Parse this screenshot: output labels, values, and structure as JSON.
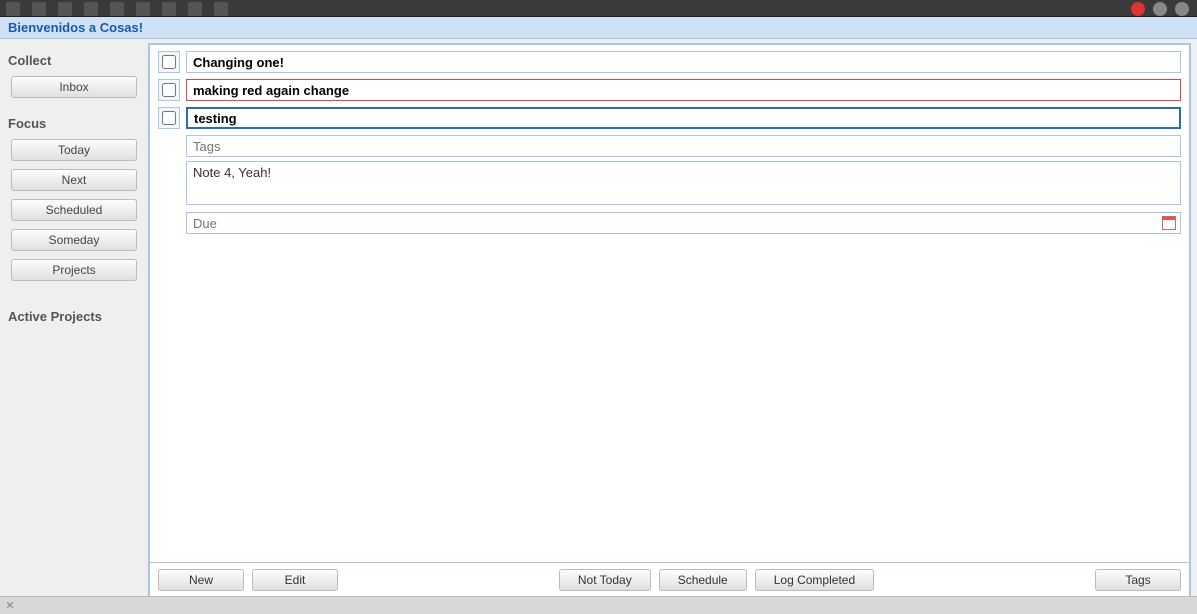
{
  "welcome": "Bienvenidos a Cosas!",
  "sidebar": {
    "sections": {
      "collect": {
        "title": "Collect",
        "items": [
          "Inbox"
        ]
      },
      "focus": {
        "title": "Focus",
        "items": [
          "Today",
          "Next",
          "Scheduled",
          "Someday",
          "Projects"
        ]
      },
      "active_projects": {
        "title": "Active Projects"
      }
    }
  },
  "tasks": [
    {
      "title": "Changing one!",
      "checked": false,
      "selected": false,
      "red": false
    },
    {
      "title": "making red again change",
      "checked": false,
      "selected": false,
      "red": true
    },
    {
      "title": "testing",
      "checked": false,
      "selected": true,
      "red": false
    }
  ],
  "detail": {
    "tags_placeholder": "Tags",
    "note": "Note 4, Yeah!",
    "due_placeholder": "Due"
  },
  "actions": {
    "new": "New",
    "edit": "Edit",
    "not_today": "Not Today",
    "schedule": "Schedule",
    "log_completed": "Log Completed",
    "tags": "Tags"
  }
}
